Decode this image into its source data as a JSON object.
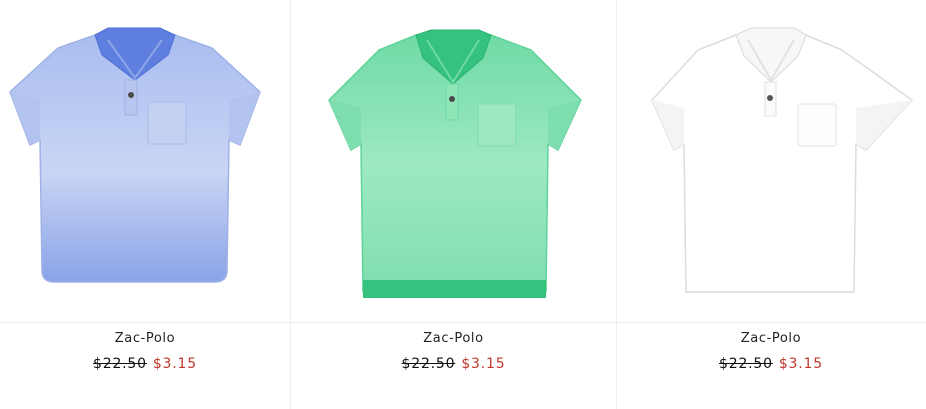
{
  "products": [
    {
      "name": "Zac-Polo",
      "original_price": "$22.50",
      "sale_price": "$3.15",
      "image_icon": "polo-shirt-blue-icon",
      "colors": {
        "body": "#b9c8ef",
        "shade": "#8da4e6",
        "collar": "#5f7fe0"
      }
    },
    {
      "name": "Zac-Polo",
      "original_price": "$22.50",
      "sale_price": "$3.15",
      "image_icon": "polo-shirt-green-icon",
      "colors": {
        "body": "#8ee5b8",
        "shade": "#5fd79d",
        "collar": "#35c27e"
      }
    },
    {
      "name": "Zac-Polo",
      "original_price": "$22.50",
      "sale_price": "$3.15",
      "image_icon": "polo-shirt-white-icon",
      "colors": {
        "body": "#ffffff",
        "shade": "#eeeeee",
        "collar": "#f2f2f2"
      }
    }
  ],
  "theme": {
    "sale_color": "#c0392b",
    "text_color": "#222222",
    "divider": "#ececec"
  }
}
